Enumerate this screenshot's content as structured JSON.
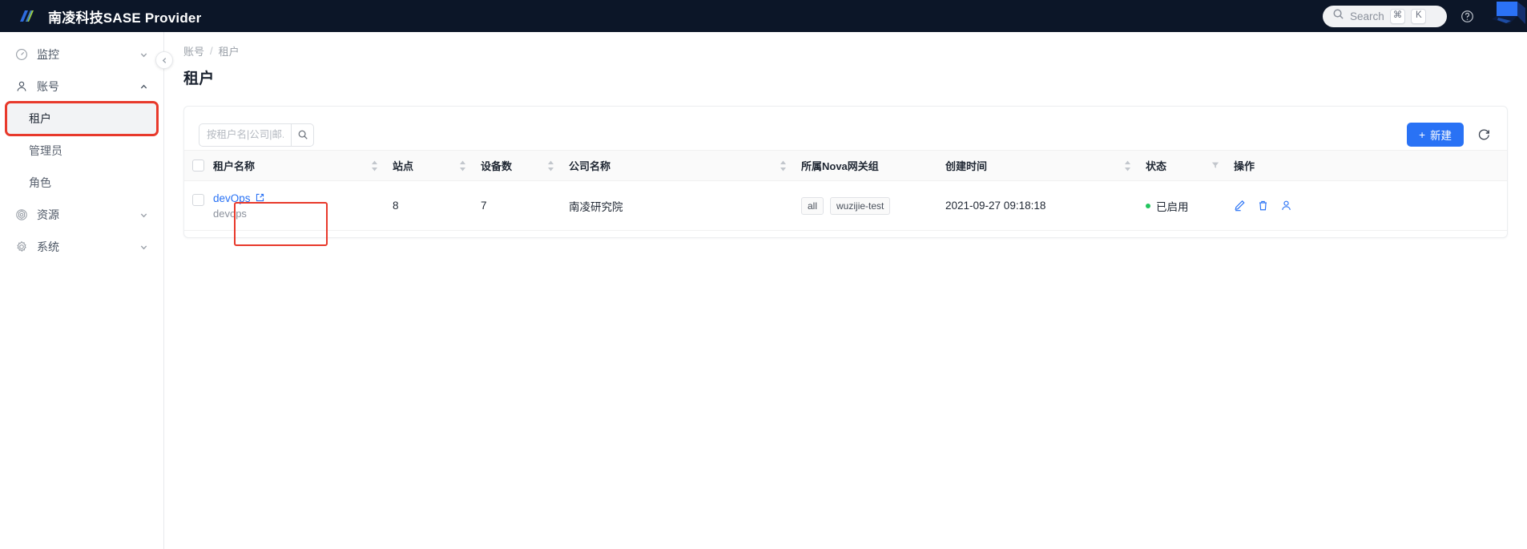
{
  "topbar": {
    "brand_title": "南凌科技SASE Provider",
    "logo_icon": "brand-slash-logo",
    "search": {
      "label": "Search",
      "icon": "search-icon",
      "kbd_cmd": "⌘",
      "kbd_key": "K"
    },
    "help_icon": "question-circle-icon",
    "corner_logo_icon": "cube-logo"
  },
  "sidebar": {
    "collapse_icon": "chevron-left-icon",
    "items": [
      {
        "label": "监控",
        "icon": "dashboard-icon",
        "chevron": "chevron-down-icon",
        "expanded": false
      },
      {
        "label": "账号",
        "icon": "user-icon",
        "chevron": "chevron-up-icon",
        "expanded": true
      },
      {
        "label": "资源",
        "icon": "resource-icon",
        "chevron": "chevron-down-icon",
        "expanded": false
      },
      {
        "label": "系统",
        "icon": "gear-icon",
        "chevron": "chevron-down-icon",
        "expanded": false
      }
    ],
    "account_children": [
      {
        "label": "租户",
        "active": true,
        "highlighted": true
      },
      {
        "label": "管理员",
        "active": false,
        "highlighted": false
      },
      {
        "label": "角色",
        "active": false,
        "highlighted": false
      }
    ]
  },
  "page": {
    "breadcrumb": {
      "parent": "账号",
      "separator": "/",
      "current": "租户"
    },
    "title": "租户"
  },
  "toolbar": {
    "search_placeholder": "按租户名|公司|邮...",
    "search_value": "",
    "search_icon": "search-icon",
    "create_label": "新建",
    "create_plus": "+",
    "refresh_icon": "refresh-icon"
  },
  "table": {
    "select_all_checkbox": false,
    "columns": [
      {
        "key": "name",
        "label": "租户名称",
        "sortable": true,
        "filterable": false
      },
      {
        "key": "sites",
        "label": "站点",
        "sortable": true,
        "filterable": false
      },
      {
        "key": "devices",
        "label": "设备数",
        "sortable": true,
        "filterable": false
      },
      {
        "key": "company",
        "label": "公司名称",
        "sortable": true,
        "filterable": false
      },
      {
        "key": "nova",
        "label": "所属Nova网关组",
        "sortable": false,
        "filterable": false
      },
      {
        "key": "created",
        "label": "创建时间",
        "sortable": true,
        "filterable": false
      },
      {
        "key": "status",
        "label": "状态",
        "sortable": false,
        "filterable": true
      },
      {
        "key": "ops",
        "label": "操作",
        "sortable": false,
        "filterable": false
      }
    ],
    "rows": [
      {
        "checked": false,
        "name": "devOps",
        "name_link_icon": "external-link-icon",
        "name_sub": "devops",
        "sites": "8",
        "devices": "7",
        "company": "南凌研究院",
        "nova_tags": [
          "all",
          "wuzijie-test"
        ],
        "created": "2021-09-27 09:18:18",
        "status_text": "已启用",
        "status_color": "#22c55e",
        "actions": [
          "edit-icon",
          "delete-icon",
          "user-icon"
        ]
      }
    ]
  },
  "annotations": {
    "sidebar_box_color": "#e8392b",
    "row_box_color": "#e8392b"
  },
  "colors": {
    "topbar_bg": "#0c1628",
    "primary": "#2972f5",
    "link": "#2972f5",
    "success": "#22c55e",
    "annotation": "#e8392b"
  }
}
